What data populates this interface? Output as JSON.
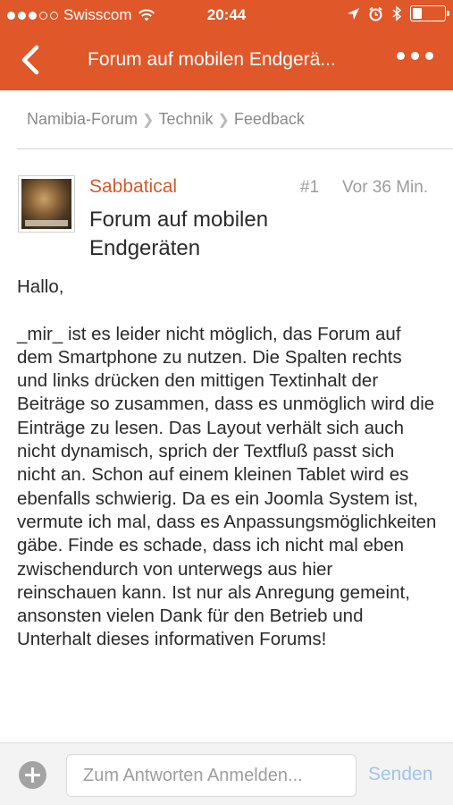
{
  "status_bar": {
    "carrier": "Swisscom",
    "time": "20:44",
    "signal_bars": 3,
    "battery_level": 0.3
  },
  "navbar": {
    "title": "Forum auf mobilen Endgerä...",
    "back_icon": "chevron-left-icon",
    "more_icon": "more-dots-icon"
  },
  "breadcrumb": [
    "Namibia-Forum",
    "Technik",
    "Feedback"
  ],
  "post": {
    "author": "Sabbatical",
    "number": "#1",
    "time": "Vor 36 Min.",
    "title": "Forum auf mobilen Endgeräten",
    "body": "Hallo,\n\n_mir_ ist es leider nicht möglich, das Forum auf dem Smartphone zu nutzen. Die Spalten rechts und links drücken den mittigen Textinhalt der Beiträge so zusammen, dass es unmöglich wird die Einträge zu lesen. Das Layout verhält sich auch nicht dynamisch, sprich der Textfluß passt sich nicht an. Schon auf einem kleinen Tablet wird es ebenfalls schwierig. Da es ein Joomla System ist, vermute ich mal, dass es Anpassungsmöglichkeiten gäbe. Finde es schade, dass ich nicht mal eben zwischendurch von unterwegs aus hier reinschauen kann. Ist nur als Anregung gemeint, ansonsten vielen Dank für den Betrieb und Unterhalt dieses informativen Forums!"
  },
  "reply_bar": {
    "placeholder": "Zum Antworten Anmelden...",
    "value": "",
    "send_label": "Senden"
  },
  "colors": {
    "header": "#e0572a",
    "author": "#d05a2c",
    "send": "#9fc4ea"
  }
}
